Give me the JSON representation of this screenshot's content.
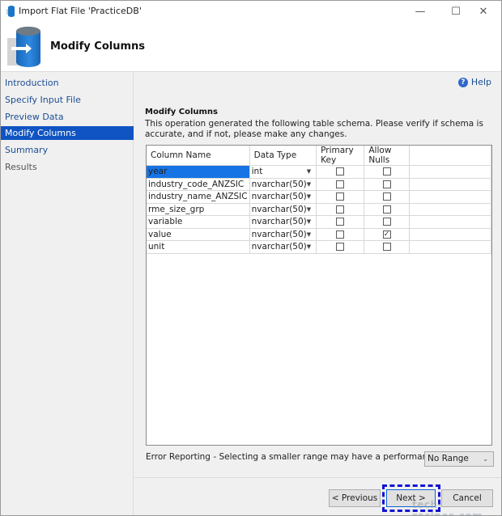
{
  "window": {
    "title": "Import Flat File 'PracticeDB'",
    "minimize_glyph": "—",
    "maximize_glyph": "☐",
    "close_glyph": "✕"
  },
  "header": {
    "title": "Modify Columns",
    "icon": "database-import-icon"
  },
  "sidebar": {
    "items": [
      {
        "label": "Introduction",
        "state": "link"
      },
      {
        "label": "Specify Input File",
        "state": "link"
      },
      {
        "label": "Preview Data",
        "state": "link"
      },
      {
        "label": "Modify Columns",
        "state": "active"
      },
      {
        "label": "Summary",
        "state": "link"
      },
      {
        "label": "Results",
        "state": "disabled"
      }
    ]
  },
  "main": {
    "help_label": "Help",
    "help_glyph": "?",
    "section_title": "Modify Columns",
    "description": "This operation generated the following table schema. Please verify if schema is accurate, and if not, please make any changes."
  },
  "schema": {
    "headers": [
      "Column Name",
      "Data Type",
      "Primary Key",
      "Allow Nulls"
    ],
    "rows": [
      {
        "name": "year",
        "type": "int",
        "primary_key": false,
        "allow_nulls": false,
        "selected": true
      },
      {
        "name": "industry_code_ANZSIC",
        "type": "nvarchar(50)",
        "primary_key": false,
        "allow_nulls": false
      },
      {
        "name": "industry_name_ANZSIC",
        "type": "nvarchar(50)",
        "primary_key": false,
        "allow_nulls": false
      },
      {
        "name": "rme_size_grp",
        "type": "nvarchar(50)",
        "primary_key": false,
        "allow_nulls": false
      },
      {
        "name": "variable",
        "type": "nvarchar(50)",
        "primary_key": false,
        "allow_nulls": false
      },
      {
        "name": "value",
        "type": "nvarchar(50)",
        "primary_key": false,
        "allow_nulls": true
      },
      {
        "name": "unit",
        "type": "nvarchar(50)",
        "primary_key": false,
        "allow_nulls": false
      }
    ]
  },
  "error_reporting": {
    "label": "Error Reporting - Selecting a smaller range may have a performance impact",
    "selected": "No Range"
  },
  "buttons": {
    "previous": "< Previous",
    "next": "Next >",
    "cancel": "Cancel"
  },
  "watermark": "tech-recipes.com",
  "colors": {
    "accent": "#0f54c2",
    "selection": "#1674e5",
    "link": "#1c4e94",
    "focus_outline": "#1212d4"
  }
}
